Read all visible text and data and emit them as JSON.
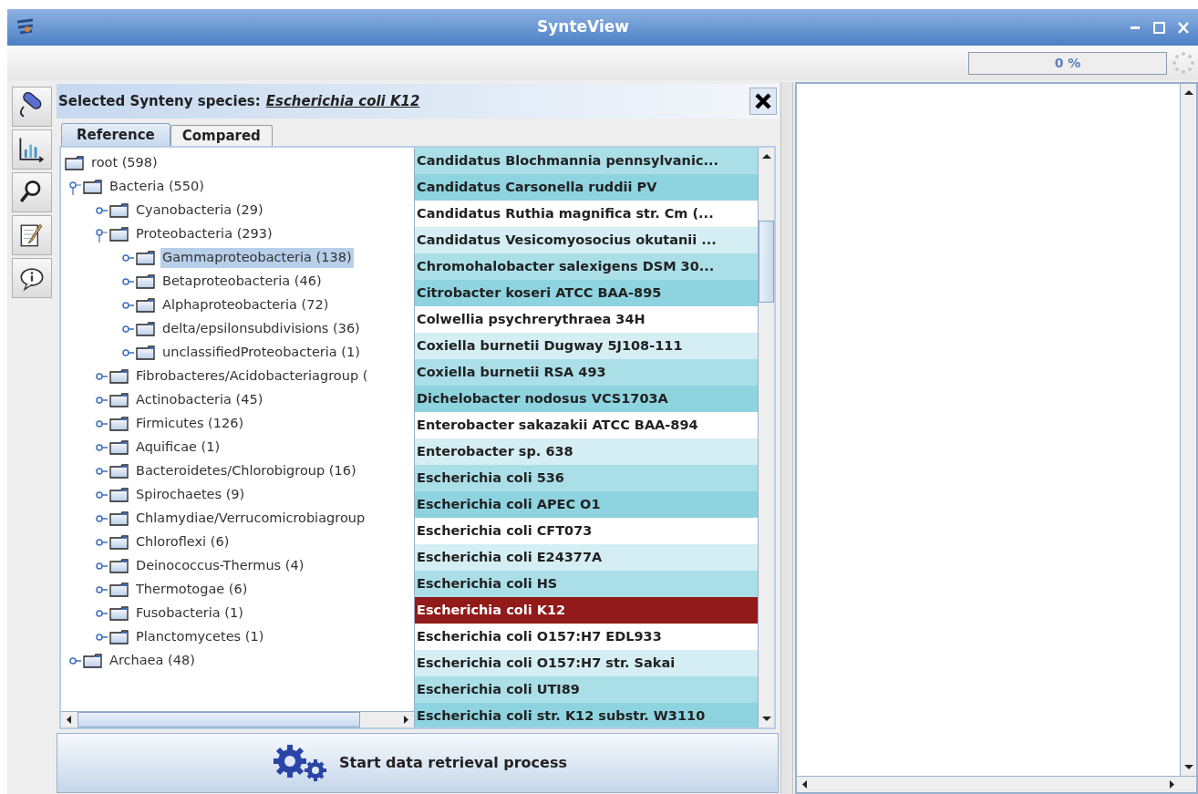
{
  "window": {
    "title": "SynteView"
  },
  "progress": {
    "label": "0 %",
    "level": 0
  },
  "header": {
    "label": "Selected Synteny species:",
    "species": "Escherichia coli K12"
  },
  "tabs": [
    {
      "label": "Reference",
      "selected": true
    },
    {
      "label": "Compared",
      "selected": false
    }
  ],
  "tree": [
    {
      "label": "root (598)",
      "selected": false,
      "children": [
        {
          "label": "Bacteria (550)",
          "expanded": true,
          "selected": false,
          "children": [
            {
              "label": "Cyanobacteria (29)",
              "expanded": false,
              "selected": false
            },
            {
              "label": "Proteobacteria (293)",
              "expanded": true,
              "selected": false,
              "children": [
                {
                  "label": "Gammaproteobacteria (138)",
                  "expanded": false,
                  "selected": true
                },
                {
                  "label": "Betaproteobacteria (46)",
                  "expanded": false,
                  "selected": false
                },
                {
                  "label": "Alphaproteobacteria (72)",
                  "expanded": false,
                  "selected": false
                },
                {
                  "label": "delta/epsilonsubdivisions (36)",
                  "expanded": false,
                  "selected": false
                },
                {
                  "label": "unclassifiedProteobacteria (1)",
                  "expanded": false,
                  "selected": false
                }
              ]
            },
            {
              "label": "Fibrobacteres/Acidobacteriagroup (",
              "expanded": false,
              "selected": false
            },
            {
              "label": "Actinobacteria (45)",
              "expanded": false,
              "selected": false
            },
            {
              "label": "Firmicutes (126)",
              "expanded": false,
              "selected": false
            },
            {
              "label": "Aquificae (1)",
              "expanded": false,
              "selected": false
            },
            {
              "label": "Bacteroidetes/Chlorobigroup (16)",
              "expanded": false,
              "selected": false
            },
            {
              "label": "Spirochaetes (9)",
              "expanded": false,
              "selected": false
            },
            {
              "label": "Chlamydiae/Verrucomicrobiagroup",
              "expanded": false,
              "selected": false
            },
            {
              "label": "Chloroflexi (6)",
              "expanded": false,
              "selected": false
            },
            {
              "label": "Deinococcus-Thermus (4)",
              "expanded": false,
              "selected": false
            },
            {
              "label": "Thermotogae (6)",
              "expanded": false,
              "selected": false
            },
            {
              "label": "Fusobacteria (1)",
              "expanded": false,
              "selected": false
            },
            {
              "label": "Planctomycetes (1)",
              "expanded": false,
              "selected": false
            }
          ]
        },
        {
          "label": "Archaea (48)",
          "expanded": false,
          "selected": false
        }
      ]
    }
  ],
  "species_list": [
    {
      "label": "Candidatus Blochmannia pennsylvanic...",
      "color": "#aadfe8",
      "selected": false
    },
    {
      "label": "Candidatus Carsonella ruddii PV",
      "color": "#8ed4e0",
      "selected": false
    },
    {
      "label": "Candidatus Ruthia magnifica str. Cm (...",
      "color": "#ffffff",
      "selected": false
    },
    {
      "label": "Candidatus Vesicomyosocius okutanii ...",
      "color": "#d4eef3",
      "selected": false
    },
    {
      "label": "Chromohalobacter salexigens DSM 30...",
      "color": "#aadfe8",
      "selected": false
    },
    {
      "label": "Citrobacter koseri ATCC BAA-895",
      "color": "#8ed4e0",
      "selected": false
    },
    {
      "label": "Colwellia psychrerythraea 34H",
      "color": "#ffffff",
      "selected": false
    },
    {
      "label": "Coxiella burnetii Dugway 5J108-111",
      "color": "#d4eef3",
      "selected": false
    },
    {
      "label": "Coxiella burnetii RSA 493",
      "color": "#aadfe8",
      "selected": false
    },
    {
      "label": "Dichelobacter nodosus VCS1703A",
      "color": "#8ed4e0",
      "selected": false
    },
    {
      "label": "Enterobacter sakazakii ATCC BAA-894",
      "color": "#ffffff",
      "selected": false
    },
    {
      "label": "Enterobacter sp. 638",
      "color": "#d4eef3",
      "selected": false
    },
    {
      "label": "Escherichia coli 536",
      "color": "#aadfe8",
      "selected": false
    },
    {
      "label": "Escherichia coli APEC O1",
      "color": "#8ed4e0",
      "selected": false
    },
    {
      "label": "Escherichia coli CFT073",
      "color": "#ffffff",
      "selected": false
    },
    {
      "label": "Escherichia coli E24377A",
      "color": "#d4eef3",
      "selected": false
    },
    {
      "label": "Escherichia coli HS",
      "color": "#aadfe8",
      "selected": false
    },
    {
      "label": "Escherichia coli K12",
      "selected": true
    },
    {
      "label": "Escherichia coli O157:H7 EDL933",
      "color": "#ffffff",
      "selected": false
    },
    {
      "label": "Escherichia coli O157:H7 str. Sakai",
      "color": "#d4eef3",
      "selected": false
    },
    {
      "label": "Escherichia coli UTI89",
      "color": "#aadfe8",
      "selected": false
    },
    {
      "label": "Escherichia coli str. K12 substr. W3110",
      "color": "#8ed4e0",
      "selected": false
    }
  ],
  "start_button": {
    "label": "Start data retrieval process"
  }
}
